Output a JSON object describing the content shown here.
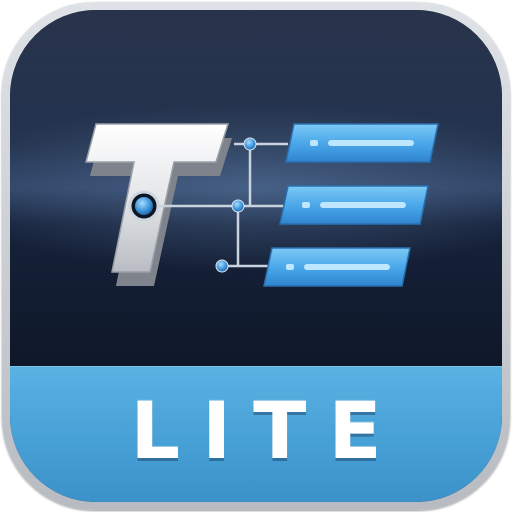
{
  "app_icon": {
    "badge_text": "LITE",
    "colors": {
      "dark_panel": "#101a2a",
      "bottom_band": "#4aa5da",
      "bars": "#4aa8ea",
      "letter": "#e9ebee",
      "nodes": "#3d8ed8"
    },
    "tree_items_count_visible": 3
  }
}
